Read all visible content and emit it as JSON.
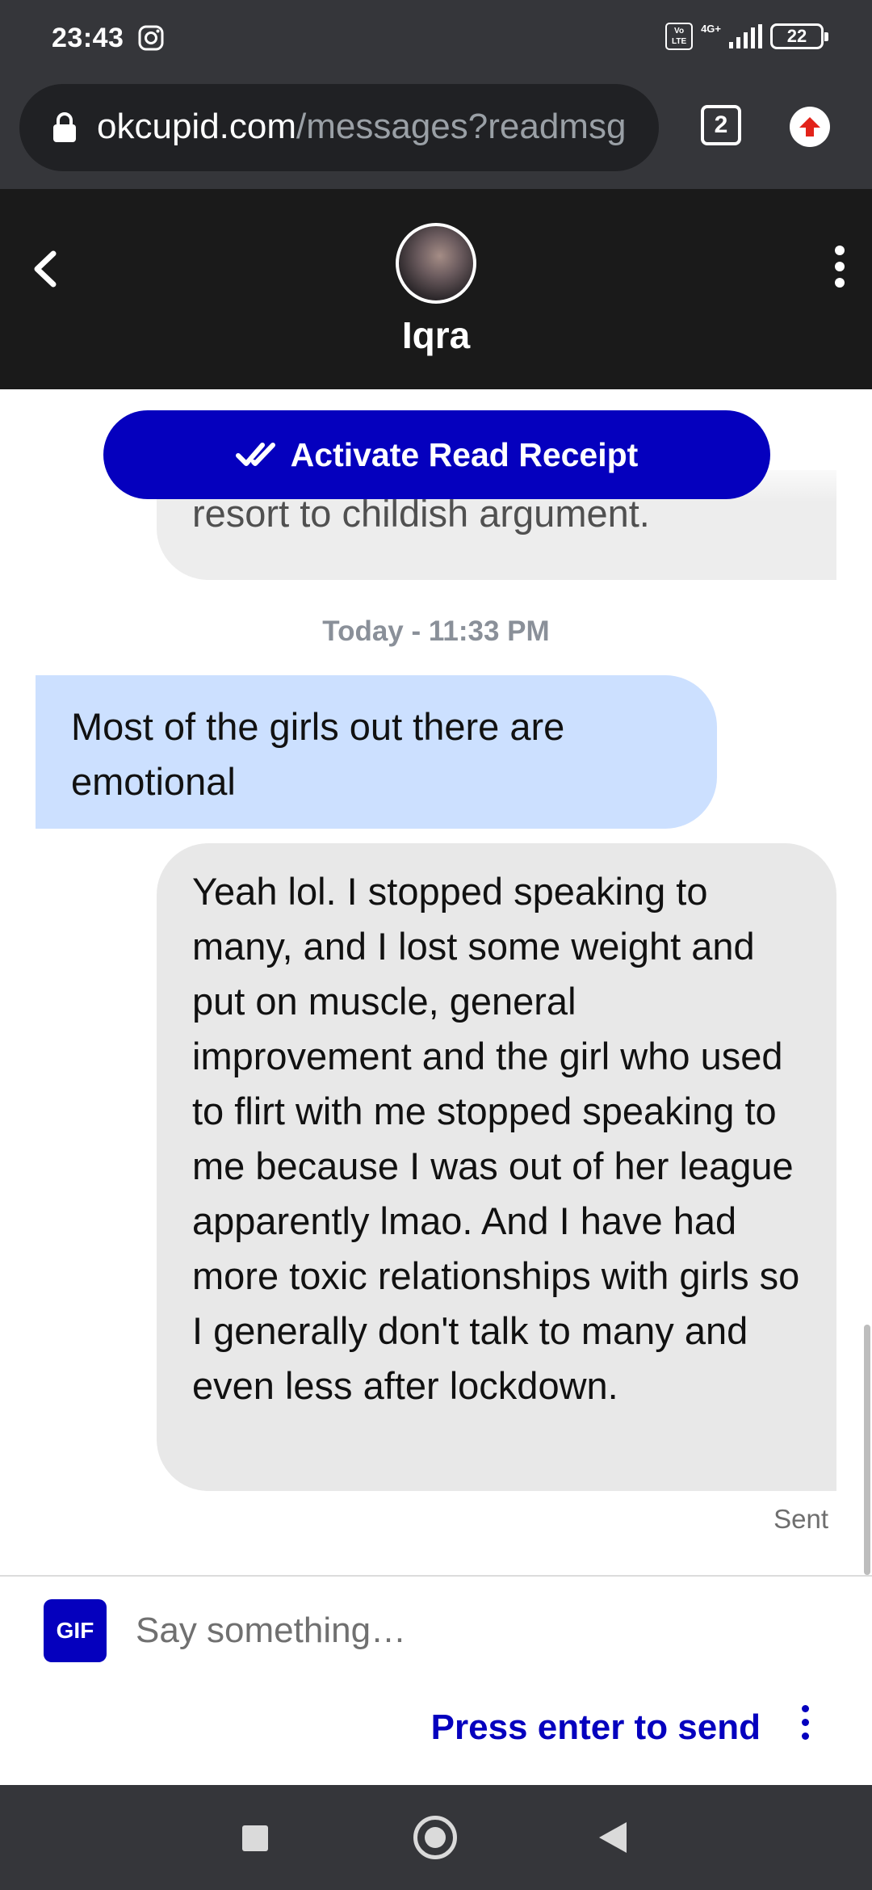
{
  "status_bar": {
    "time": "23:43",
    "volte_label": "Vo LTE",
    "network_label": "4G+",
    "battery_level": "22",
    "icons": [
      "instagram-icon",
      "volte-icon",
      "signal-icon",
      "battery-icon"
    ]
  },
  "browser": {
    "url_domain": "okcupid.com",
    "url_path": "/messages?readmsg",
    "tab_count": "2",
    "icons": [
      "lock-icon",
      "tabs-icon",
      "update-icon"
    ]
  },
  "chat_header": {
    "contact_name": "Iqra",
    "icons": [
      "back-arrow-icon",
      "more-vert-icon"
    ]
  },
  "chat": {
    "read_receipt_button": "Activate Read Receipt",
    "previous_message_fragment": "resort to childish argument.",
    "timestamp": "Today - 11:33 PM",
    "messages": [
      {
        "direction": "incoming",
        "text": "Most of the girls out there are emotional"
      },
      {
        "direction": "outgoing",
        "text": "Yeah lol. I stopped speaking to many, and I lost some weight and put on muscle, general improvement and the girl who used to flirt with me stopped speaking to me because I was out of her league apparently lmao. And I have had more toxic relationships with girls so I generally don't talk to many and even less after lockdown."
      }
    ],
    "delivery_status": "Sent"
  },
  "composer": {
    "gif_label": "GIF",
    "placeholder": "Say something…",
    "value": "",
    "send_hint": "Press enter to send"
  },
  "colors": {
    "okcupid_blue": "#0500be",
    "incoming_bubble": "#cce0ff",
    "outgoing_bubble": "#e8e8e8",
    "header_bg": "#1a1a1a",
    "chrome_bg": "#35363a"
  }
}
